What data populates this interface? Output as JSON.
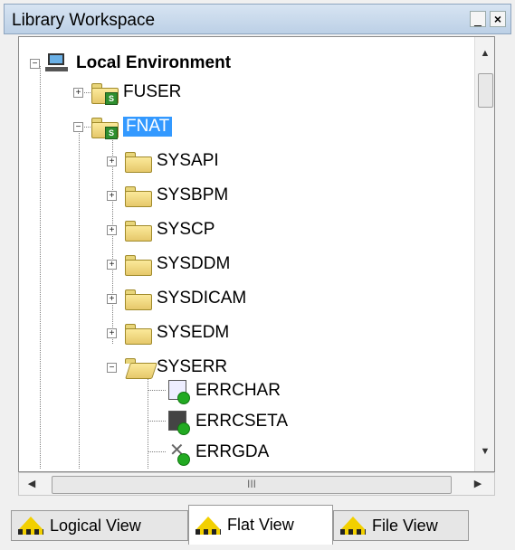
{
  "window": {
    "title": "Library Workspace"
  },
  "tree": {
    "root": {
      "label": "Local Environment",
      "expanded": true
    },
    "libraries": [
      {
        "label": "FUSER",
        "expanded": false,
        "selected": false
      },
      {
        "label": "FNAT",
        "expanded": true,
        "selected": true
      }
    ],
    "fnat_children": [
      {
        "label": "SYSAPI",
        "expanded": false
      },
      {
        "label": "SYSBPM",
        "expanded": false
      },
      {
        "label": "SYSCP",
        "expanded": false
      },
      {
        "label": "SYSDDM",
        "expanded": false
      },
      {
        "label": "SYSDICAM",
        "expanded": false
      },
      {
        "label": "SYSEDM",
        "expanded": false
      },
      {
        "label": "SYSERR",
        "expanded": true
      }
    ],
    "syserr_children": [
      {
        "label": "ERRCHAR",
        "icon": "text-object-icon"
      },
      {
        "label": "ERRCSETA",
        "icon": "table-object-icon"
      },
      {
        "label": "ERRGDA",
        "icon": "gda-object-icon"
      }
    ]
  },
  "tabs": [
    {
      "label": "Logical View",
      "active": false
    },
    {
      "label": "Flat View",
      "active": true
    },
    {
      "label": "File View",
      "active": false
    }
  ],
  "colors": {
    "selection": "#3399ff",
    "folder": "#f0d97c",
    "badge": "#2f8f2f"
  }
}
